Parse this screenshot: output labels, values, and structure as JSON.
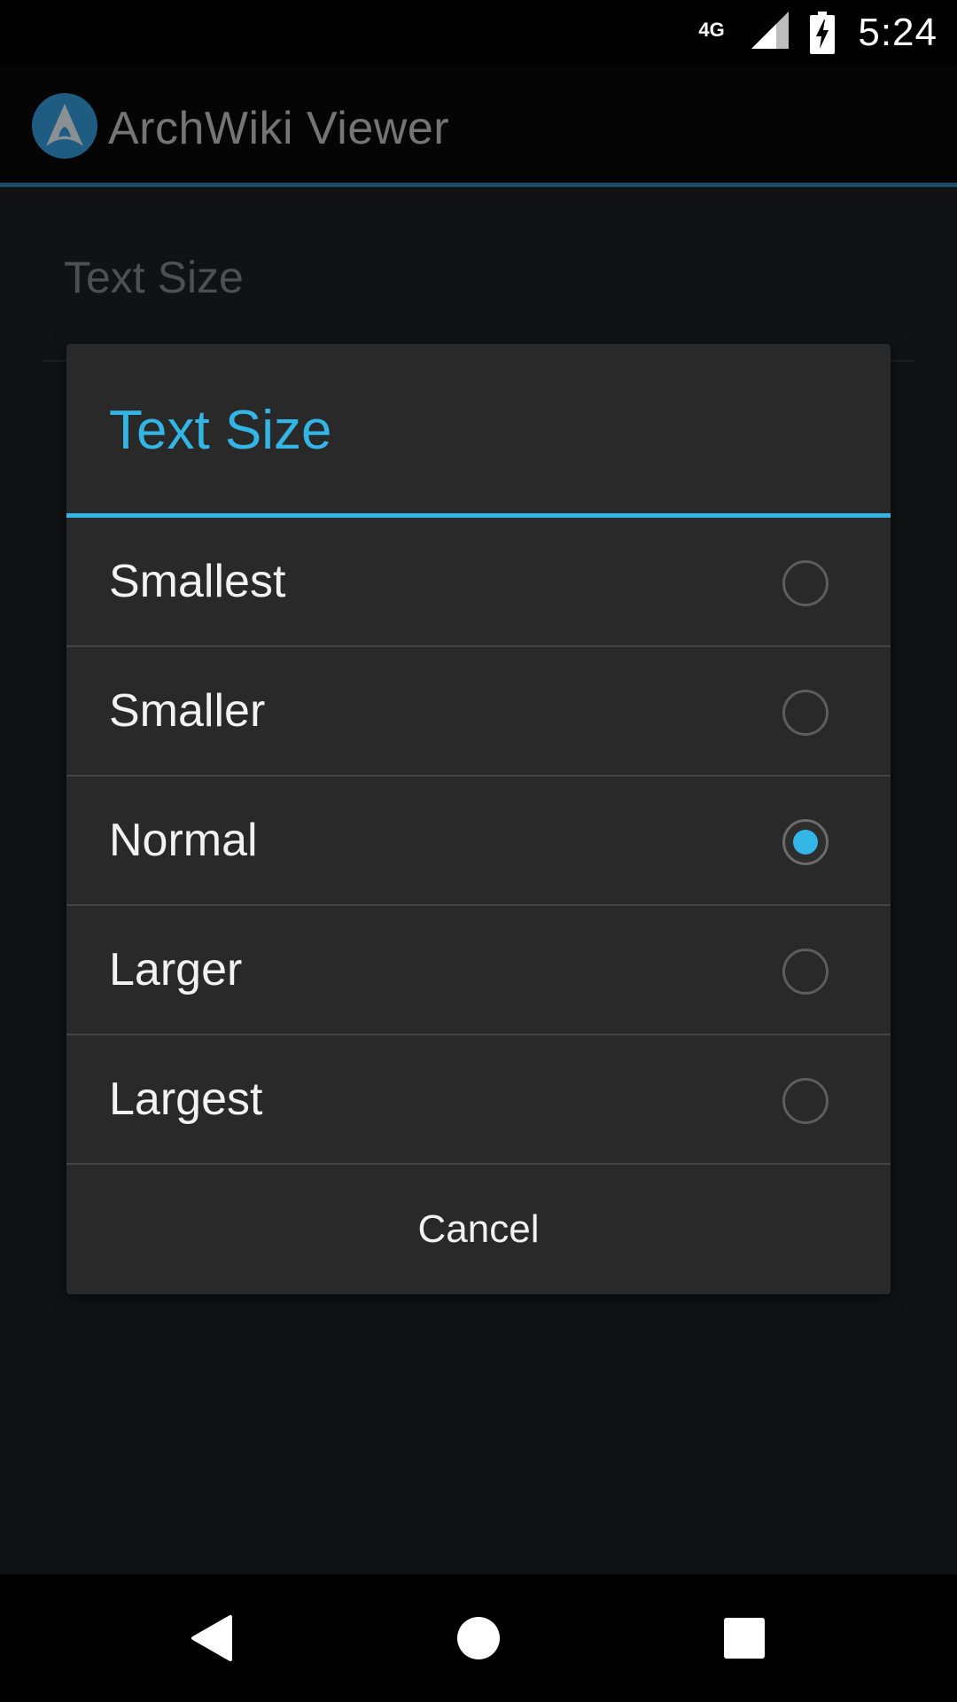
{
  "status_bar": {
    "network": "4G",
    "time": "5:24",
    "icons": [
      "signal-icon",
      "battery-charging-icon"
    ]
  },
  "app_bar": {
    "logo_icon": "arch-linux-logo-icon",
    "title": "ArchWiki Viewer"
  },
  "settings": {
    "preference_title": "Text Size"
  },
  "dialog": {
    "title": "Text Size",
    "accent_color": "#33b5e5",
    "options": [
      {
        "label": "Smallest",
        "checked": false
      },
      {
        "label": "Smaller",
        "checked": false
      },
      {
        "label": "Normal",
        "checked": true
      },
      {
        "label": "Larger",
        "checked": false
      },
      {
        "label": "Largest",
        "checked": false
      }
    ],
    "cancel_label": "Cancel"
  },
  "nav_bar": {
    "icons": [
      "back-icon",
      "home-icon",
      "recent-apps-icon"
    ]
  }
}
